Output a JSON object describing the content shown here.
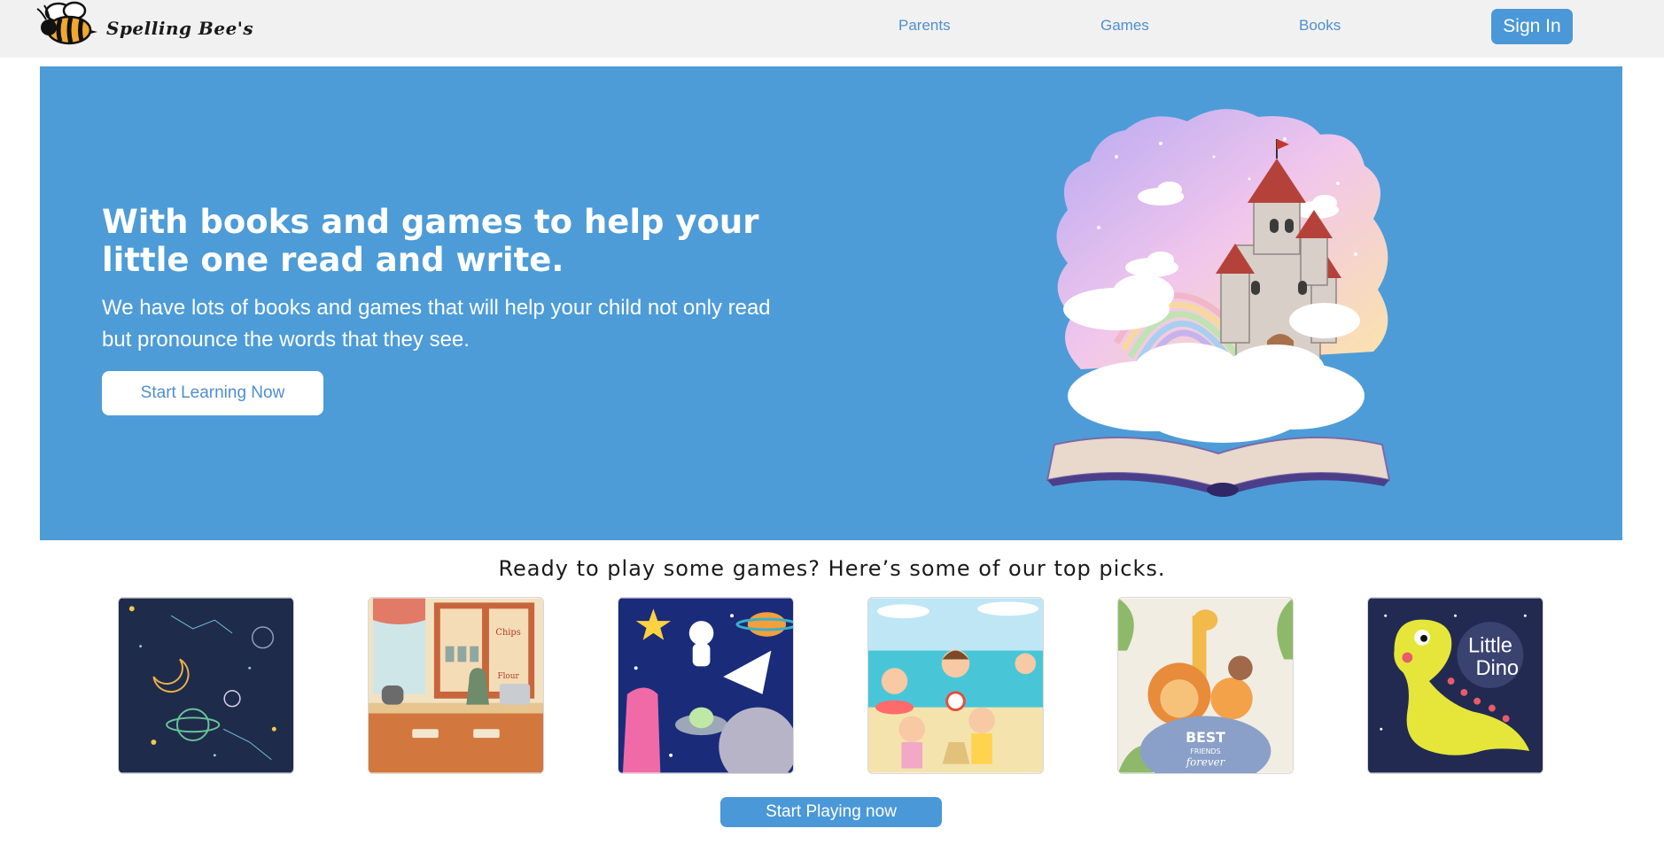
{
  "brand": {
    "name": "Spelling Bee's"
  },
  "nav": {
    "links": [
      "Parents",
      "Games",
      "Books"
    ],
    "sign_in": "Sign In"
  },
  "hero": {
    "title": "With books and games to help your little one read and write.",
    "subtitle": "We have lots of books and games that will help your child not only read but pronounce the words that they see.",
    "cta": "Start Learning Now"
  },
  "games": {
    "heading": "Ready to play some games? Here’s some of our top picks.",
    "cards": [
      {
        "theme": "space-constellations"
      },
      {
        "theme": "kitchen",
        "labels": [
          "Chips",
          "Flour"
        ]
      },
      {
        "theme": "outer-space-adventure"
      },
      {
        "theme": "beach-kids"
      },
      {
        "theme": "best-friends-animals",
        "labels": [
          "BEST",
          "FRIENDS",
          "forever"
        ]
      },
      {
        "theme": "little-dino",
        "labels": [
          "Little",
          "Dino"
        ]
      }
    ],
    "cta": "Start Playing now"
  },
  "colors": {
    "primary": "#4a98d8",
    "hero_bg": "#4d9cd8",
    "nav_bg": "#f1f1f1",
    "link": "#4f8fcc"
  }
}
